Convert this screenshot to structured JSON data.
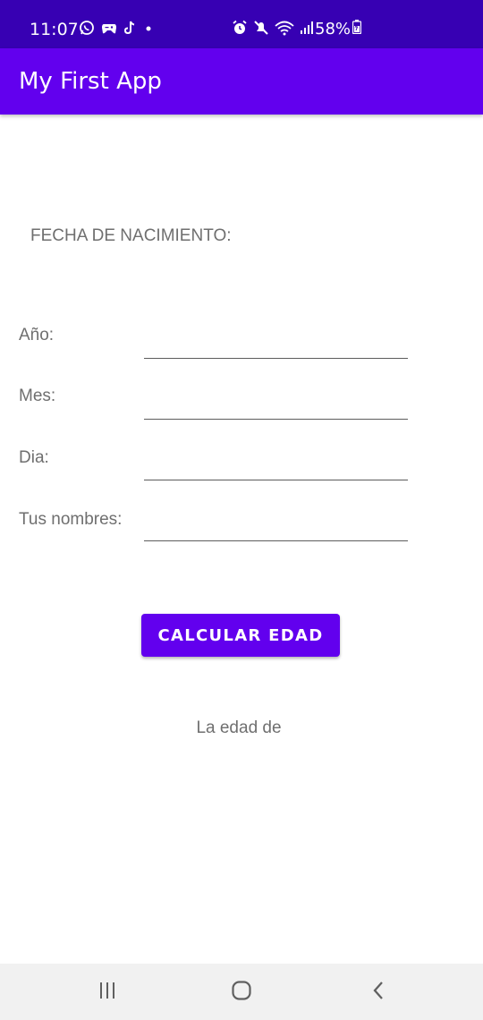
{
  "status_bar": {
    "time": "11:07",
    "battery": "58%",
    "left_icons": [
      "whatsapp-icon",
      "game-controller-icon",
      "tiktok-icon",
      "dot-icon"
    ],
    "right_icons": [
      "alarm-icon",
      "mute-icon",
      "wifi-icon",
      "signal-icon",
      "battery-icon"
    ]
  },
  "app_bar": {
    "title": "My First App"
  },
  "form": {
    "section_label": "FECHA DE NACIMIENTO:",
    "fields": [
      {
        "label": "Año:",
        "value": ""
      },
      {
        "label": "Mes:",
        "value": ""
      },
      {
        "label": "Dia:",
        "value": ""
      },
      {
        "label": "Tus nombres:",
        "value": ""
      }
    ],
    "button_label": "CALCULAR EDAD",
    "result": "La edad de"
  },
  "nav_bar": {
    "buttons": [
      "recents-icon",
      "home-icon",
      "back-icon"
    ]
  },
  "colors": {
    "status_bar": "#3700b3",
    "primary": "#6200ee",
    "text_secondary": "#6f6f6f"
  }
}
